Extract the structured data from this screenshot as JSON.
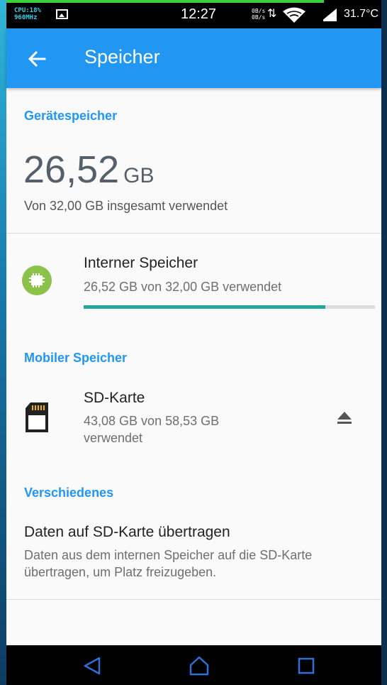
{
  "status_bar": {
    "cpu_line1": "CPU:18%",
    "cpu_line2": "960MHz",
    "time": "12:27",
    "net_up": "0B/s",
    "net_down": "0B/s",
    "temperature": "31.7°C",
    "icons": [
      "image-icon",
      "data-arrows-icon",
      "wifi-icon",
      "signal-icon"
    ]
  },
  "app_bar": {
    "title": "Speicher",
    "back_icon": "arrow-back-icon",
    "color": "#2196f3"
  },
  "device_storage": {
    "header": "Gerätespeicher",
    "used_value": "26,52",
    "used_unit": "GB",
    "summary": "Von 32,00 GB insgesamt verwendet"
  },
  "internal_storage": {
    "title": "Interner Speicher",
    "subtitle": "26,52 GB von 32,00 GB verwendet",
    "used_fraction": 0.8288,
    "icon": "chip-icon",
    "bar_color": "#26a69a"
  },
  "portable_storage": {
    "header": "Mobiler Speicher",
    "title": "SD-Karte",
    "subtitle_line1": "43,08 GB von 58,53 GB",
    "subtitle_line2": "verwendet",
    "icon": "sd-card-icon",
    "action_icon": "eject-icon"
  },
  "misc": {
    "header": "Verschiedenes",
    "title": "Daten auf SD-Karte übertragen",
    "desc_line1": "Daten aus dem internen Speicher auf die SD-Karte",
    "desc_line2": "übertragen, um Platz freizugeben."
  },
  "nav_bar": {
    "icons": [
      "nav-back-icon",
      "nav-home-icon",
      "nav-recents-icon"
    ],
    "color": "#2f6fd6"
  }
}
